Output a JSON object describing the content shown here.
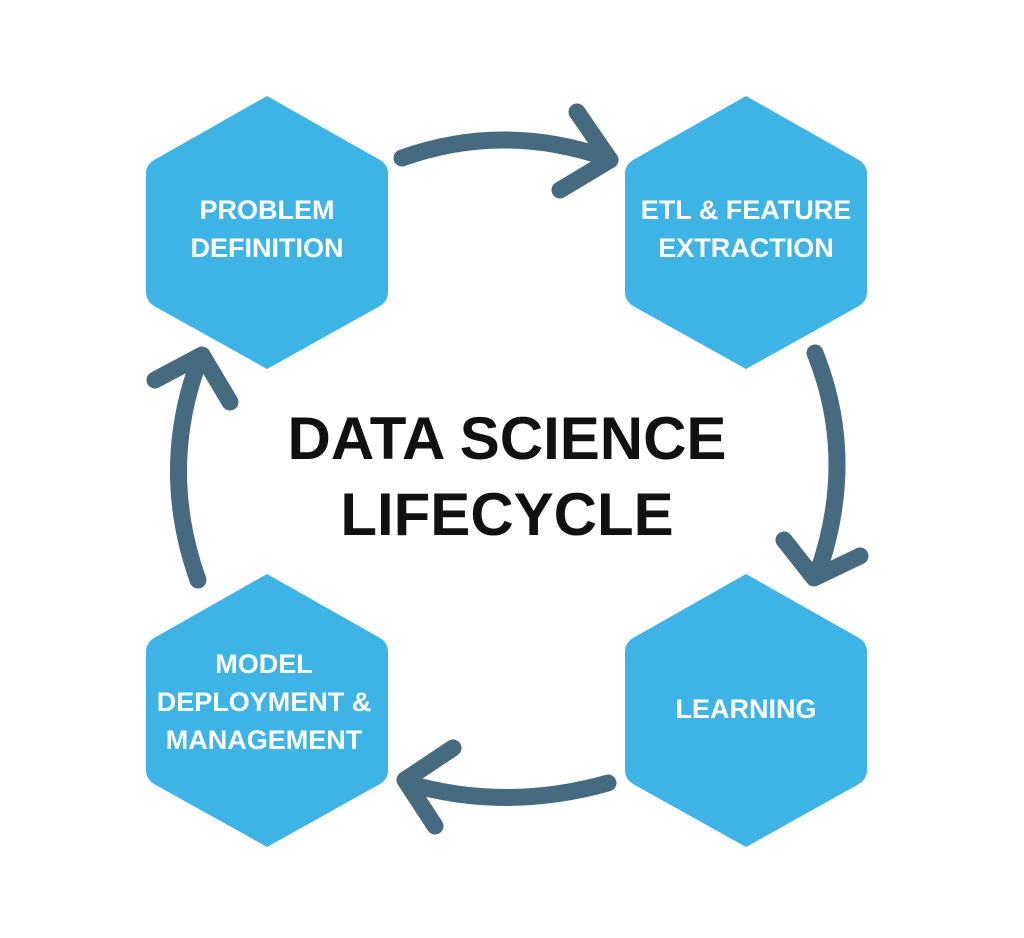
{
  "title": {
    "lines": [
      "DATA SCIENCE",
      "LIFECYCLE"
    ]
  },
  "stages": [
    {
      "id": "problem-definition",
      "lines": [
        "PROBLEM",
        "DEFINITION"
      ]
    },
    {
      "id": "etl-feature-extraction",
      "lines": [
        "ETL & FEATURE",
        "EXTRACTION"
      ]
    },
    {
      "id": "learning",
      "lines": [
        "LEARNING"
      ]
    },
    {
      "id": "model-deployment-management",
      "lines": [
        "MODEL",
        "DEPLOYMENT &",
        "MANAGEMENT"
      ]
    }
  ],
  "colors": {
    "hexagon": "#3eb4e6",
    "arrow": "#466a80",
    "hex_text": "#ffffff",
    "title_text": "#111111",
    "background": "#ffffff"
  }
}
